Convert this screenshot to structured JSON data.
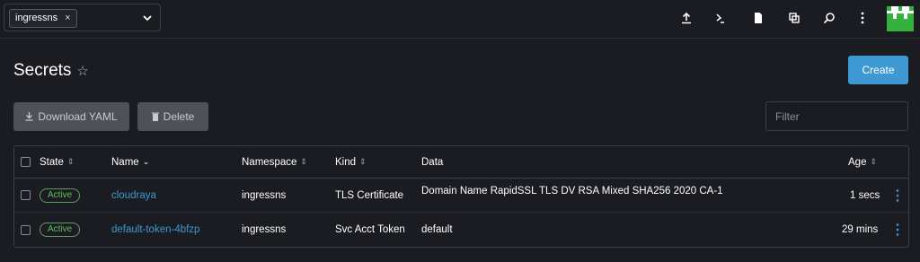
{
  "topbar": {
    "namespace_chip": "ingressns",
    "chip_remove": "×",
    "icons": [
      "import-yaml-icon",
      "kubectl-shell-icon",
      "kubeconfig-icon",
      "copy-icon",
      "search-icon",
      "more-icon"
    ]
  },
  "header": {
    "title": "Secrets",
    "create_label": "Create"
  },
  "actions": {
    "download_label": "Download YAML",
    "delete_label": "Delete",
    "filter_placeholder": "Filter"
  },
  "table": {
    "columns": {
      "state": "State",
      "name": "Name",
      "namespace": "Namespace",
      "kind": "Kind",
      "data": "Data",
      "age": "Age"
    },
    "rows": [
      {
        "state": "Active",
        "name": "cloudraya",
        "namespace": "ingressns",
        "kind": "TLS Certificate",
        "data": "Domain Name RapidSSL TLS DV RSA Mixed SHA256 2020 CA-1",
        "age": "1 secs"
      },
      {
        "state": "Active",
        "name": "default-token-4bfzp",
        "namespace": "ingressns",
        "kind": "Svc Acct Token",
        "data": "default",
        "age": "29 mins"
      }
    ]
  },
  "colors": {
    "accent": "#3d98d3",
    "active": "#5fbf5f",
    "background": "#1b1c21"
  }
}
